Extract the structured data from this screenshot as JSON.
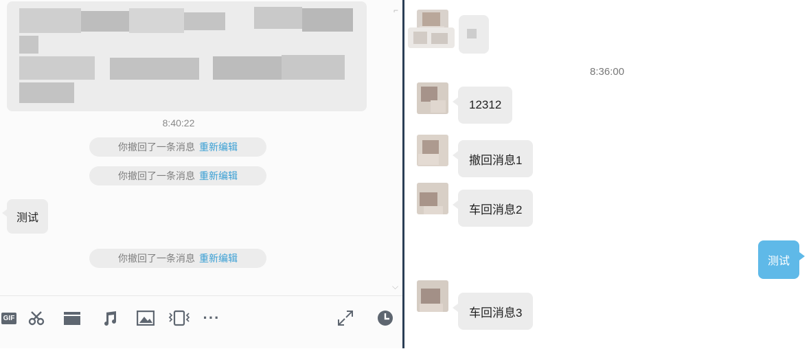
{
  "left_chat": {
    "timestamp": "8:40:22",
    "recall_notices": [
      {
        "text": "你撤回了一条消息",
        "action": "重新编辑"
      },
      {
        "text": "你撤回了一条消息",
        "action": "重新编辑"
      },
      {
        "text": "你撤回了一条消息",
        "action": "重新编辑"
      }
    ],
    "incoming_message": "测试",
    "toolbar": {
      "gif_label": "GIF",
      "more_label": "···",
      "icons": [
        "gif-icon",
        "scissors-icon",
        "folder-icon",
        "music-icon",
        "image-icon",
        "screen-shake-icon",
        "more-icon",
        "expand-icon",
        "history-clock-icon"
      ]
    }
  },
  "right_chat": {
    "timestamp": "8:36:00",
    "messages": [
      {
        "text": "12312"
      },
      {
        "text": "撤回消息1"
      },
      {
        "text": "车回消息2"
      },
      {
        "text": "车回消息3"
      }
    ],
    "self_message": "测试"
  },
  "colors": {
    "divider": "#2b3e55",
    "link_blue": "#3a9fd4",
    "self_bubble": "#5fb9e8",
    "bubble_gray": "#ececec"
  }
}
